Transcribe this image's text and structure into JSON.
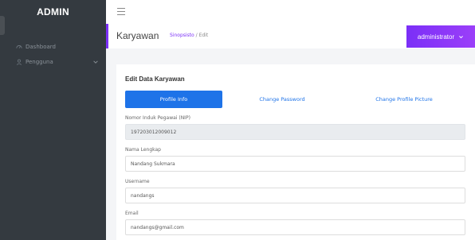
{
  "sidebar": {
    "brand": "ADMIN",
    "items": [
      {
        "label": "Dashboard",
        "icon": "gauge-icon"
      },
      {
        "label": "Pengguna",
        "icon": "user-icon"
      }
    ]
  },
  "header": {
    "title": "Karyawan",
    "breadcrumb_active": "Sinopsisto",
    "breadcrumb_sep": "/",
    "breadcrumb_current": "Edit",
    "user": "administrator"
  },
  "form": {
    "title": "Edit Data Karyawan",
    "tabs": [
      "Profile Info",
      "Change Password",
      "Change Profile Picture"
    ],
    "fields": [
      {
        "label": "Nomor Induk Pegawai (NIP)",
        "value": "197203012009012",
        "readonly": true
      },
      {
        "label": "Nama Lengkap",
        "value": "Nandang Sukmara",
        "readonly": false
      },
      {
        "label": "Username",
        "value": "nandangs",
        "readonly": false
      },
      {
        "label": "Email",
        "value": "nandangs@gmail.com",
        "readonly": false
      }
    ]
  },
  "colors": {
    "sidebar": "#343a40",
    "accent": "#7b2ff7",
    "primary": "#1e73e8"
  }
}
